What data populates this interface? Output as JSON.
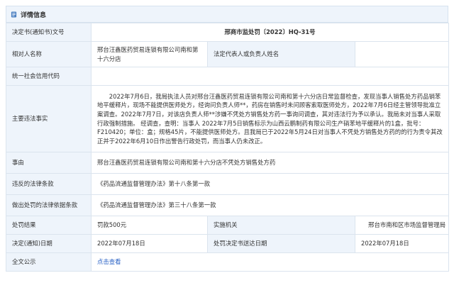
{
  "section": {
    "icon": "document-icon",
    "title": "详情信息"
  },
  "rows": {
    "decision_no": {
      "label": "决定书(通知书)文号",
      "value": "邢商市监处罚〔2022〕HQ-31号"
    },
    "party": {
      "label": "相对人名称",
      "value": "邢台汪鑫医药贸易连锁有限公司南和第十六分店",
      "rep_label": "法定代表人或负责人姓名",
      "rep_value": ""
    },
    "credit_code": {
      "label": "统一社会信用代码",
      "value": ""
    },
    "facts": {
      "label": "主要违法事实",
      "value": "2022年7月6日，我局执法人员对邢台汪鑫医药贸易连锁有限公司南和第十六分店日常监督检查，发现当事人销售处方药品销苯地平缓释片，现场不能提供医师处方，经询问负责人师**，药房在销售时未问顾客索取医师处方，2022年7月6日经主管领导批准立案调查。2022年7月7日，对该店负责人师**涉嫌不凭处方销售处方药一事询问调查，其对违法行为予以承认。我局未对当事人采取行政强制措施。 经调查，查明：当事人 2022年7月5日销售标示为山西云鹏制药有限公司生产硝苯地平缓释片的1盒，批号：F210420；单位：盒；规格45片，不能提供医师处方。且我局已于2022年5月24日对当事人不凭处方销售处方药的的行为责令其改正并于2022年6月10日作出警告行政处罚，而当事人仍未改正。"
    },
    "matter": {
      "label": "事由",
      "value": "邢台汪鑫医药贸易连锁有限公司南和第十六分店不凭处方销售处方药"
    },
    "violated_law": {
      "label": "违反的法律条款",
      "value": "《药品流通监督管理办法》第十八条第一款"
    },
    "basis_law": {
      "label": "做出处罚的法律依据条款",
      "value": "《药品流通监督管理办法》第三十八条第一款"
    },
    "result": {
      "label": "处罚结果",
      "value": "罚款500元",
      "agency_label": "实施机关",
      "agency_value": "邢台市南和区市场监督管理局"
    },
    "dates": {
      "decision_label": "决定(通知)日期",
      "decision_value": "2022年07月18日",
      "delivery_label": "处罚决定书送达日期",
      "delivery_value": "2022年07月18日"
    },
    "fulltext": {
      "label": "全文公示",
      "link": "点击查看"
    }
  },
  "colors": {
    "label_bg": "#eef4fb",
    "border": "#dbe4ee",
    "link": "#2b63c6"
  }
}
